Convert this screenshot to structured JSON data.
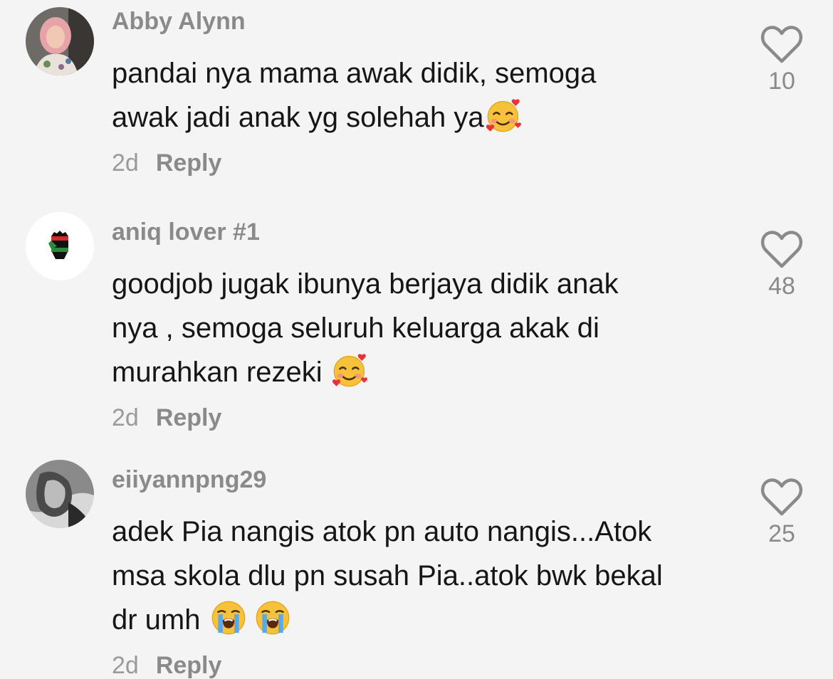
{
  "comments": [
    {
      "username": "Abby Alynn",
      "text": "pandai nya mama awak didik, semoga\nawak jadi anak yg solehah ya",
      "emojis": [
        "smiling-face-with-hearts"
      ],
      "time": "2d",
      "reply_label": "Reply",
      "likes": "10"
    },
    {
      "username": "aniq lover #1",
      "text": "goodjob jugak ibunya berjaya didik anak\nnya , semoga seluruh keluarga akak di\nmurahkan rezeki ",
      "emojis": [
        "smiling-face-with-hearts"
      ],
      "time": "2d",
      "reply_label": "Reply",
      "likes": "48"
    },
    {
      "username": "eiiyannpng29",
      "text": "adek Pia nangis atok pn auto nangis...Atok\nmsa skola dlu pn susah Pia..atok bwk bekal\ndr umh ",
      "emojis": [
        "loudly-crying-face",
        "loudly-crying-face"
      ],
      "time": "2d",
      "reply_label": "Reply",
      "likes": "25"
    }
  ],
  "icons": {
    "like": "heart-outline-icon"
  },
  "colors": {
    "background": "#f4f4f4",
    "username": "#8a8a8a",
    "text": "#161616",
    "meta": "#9a9a9a"
  }
}
